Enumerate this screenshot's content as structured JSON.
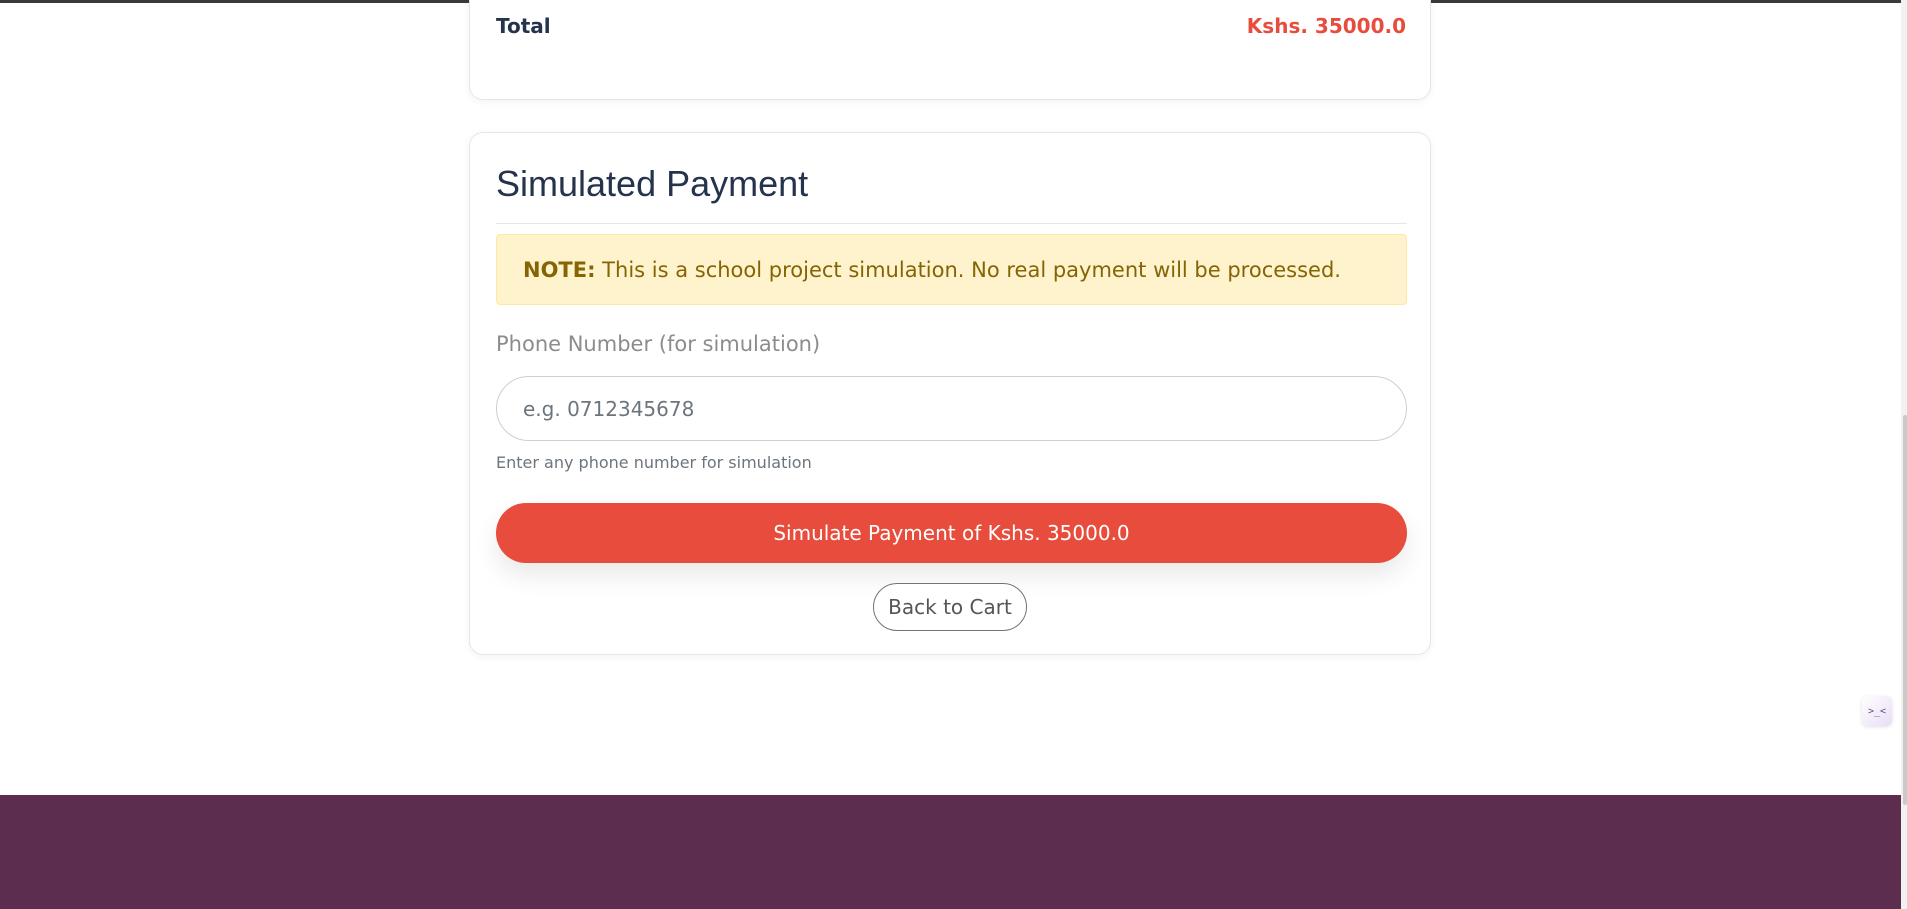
{
  "summary": {
    "total_label": "Total",
    "total_value": "Kshs. 35000.0"
  },
  "payment": {
    "title": "Simulated Payment",
    "note_strong": "NOTE:",
    "note_text": " This is a school project simulation. No real payment will be processed.",
    "phone_label": "Phone Number (for simulation)",
    "phone_placeholder": "e.g. 0712345678",
    "phone_value": "",
    "help_text": "Enter any phone number for simulation",
    "pay_button_label": "Simulate Payment of Kshs. 35000.0",
    "back_button_label": "Back to Cart"
  },
  "widget": {
    "icon": "terminal-face-icon",
    "glyph": ">_<"
  },
  "colors": {
    "accent": "#e74c3c",
    "note_bg": "#fff3cd",
    "note_text": "#856404",
    "footer_bg": "#5c2d4e",
    "heading": "#26334d"
  }
}
